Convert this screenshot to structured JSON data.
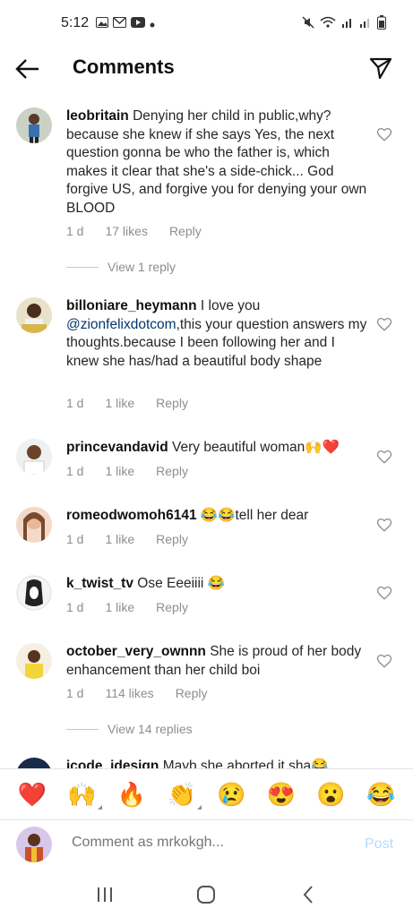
{
  "status_bar": {
    "time": "5:12",
    "left_icons": [
      "gallery-icon",
      "gmail-icon",
      "youtube-icon",
      "dot-icon"
    ],
    "right_icons": [
      "mute-icon",
      "wifi-icon",
      "signal-icon",
      "signal-icon-2",
      "battery-icon"
    ]
  },
  "header": {
    "title": "Comments"
  },
  "comments": [
    {
      "username": "leobritain",
      "text": "Denying her child in public,why? because she knew if she says Yes, the next question gonna be who the father is, which makes it clear that she's a side-chick... God forgive US, and forgive you for denying your own BLOOD",
      "time": "1 d",
      "likes": "17 likes",
      "reply": "Reply",
      "view_replies": "View 1 reply"
    },
    {
      "username": "billoniare_heymann",
      "text_before": "I love you",
      "mention": "@zionfelixdotcom",
      "text_after": ",this your question answers my thoughts.because I been following her and I knew she has/had a beautiful body shape",
      "time": "1 d",
      "likes": "1 like",
      "reply": "Reply"
    },
    {
      "username": "princevandavid",
      "text": "Very beautiful woman🙌❤️",
      "time": "1 d",
      "likes": "1 like",
      "reply": "Reply"
    },
    {
      "username": "romeodwomoh6141",
      "text": "😂😂tell her dear",
      "time": "1 d",
      "likes": "1 like",
      "reply": "Reply"
    },
    {
      "username": "k_twist_tv",
      "text": "Ose Eeeiiii 😂",
      "time": "1 d",
      "likes": "1 like",
      "reply": "Reply"
    },
    {
      "username": "october_very_ownnn",
      "text": "She is proud of her body enhancement than her child boi",
      "time": "1 d",
      "likes": "114 likes",
      "reply": "Reply",
      "view_replies": "View 14 replies"
    },
    {
      "username": "jcode_idesign",
      "text": "Mayb she aborted it sha😂"
    }
  ],
  "emoji_bar": [
    "❤️",
    "🙌",
    "🔥",
    "👏",
    "😢",
    "😍",
    "😮",
    "😂"
  ],
  "comment_input": {
    "placeholder": "Comment as mrkokgh...",
    "post_label": "Post"
  },
  "colors": {
    "mention": "#00376b",
    "meta": "#8e8e8e",
    "post_disabled": "#b3dbff"
  }
}
